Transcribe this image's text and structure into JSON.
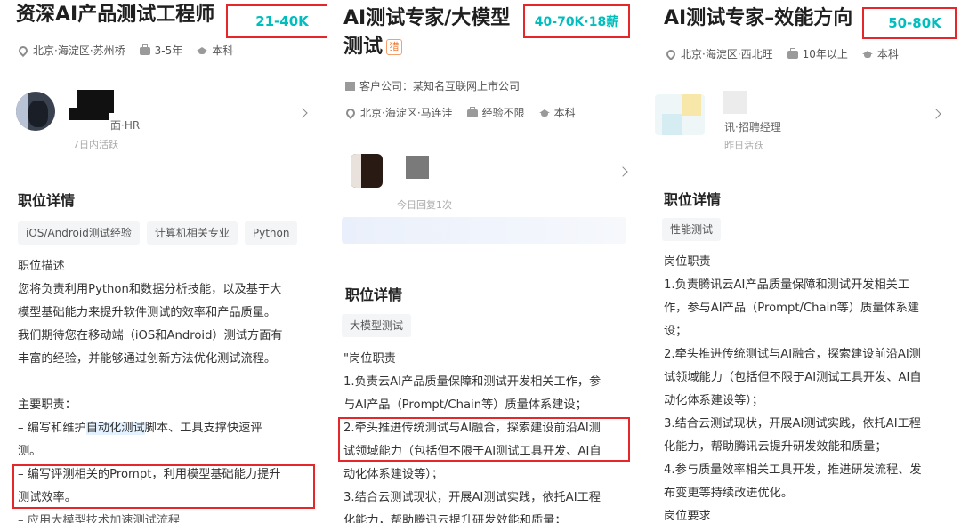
{
  "panel1": {
    "title": "资深AI产品测试工程师",
    "salary": "21-40K",
    "location": "北京·海淀区·苏州桥",
    "experience": "3-5年",
    "education": "本科",
    "hr_role": "面·HR",
    "hr_active": "7日内活跃",
    "section_title": "职位详情",
    "tags": [
      "iOS/Android测试经验",
      "计算机相关专业",
      "Python"
    ],
    "desc": {
      "heading": "职位描述",
      "p1": [
        "您将负责利用Python和数据分析技能，以及基于大",
        "模型基础能力来提升软件测试的效率和产品质量。",
        "我们期待您在移动端（iOS和Android）测试方面有",
        "丰富的经验，并能够通过创新方法优化测试流程。"
      ],
      "duties_heading": "主要职责：",
      "d1_pre": "– 编写和维护",
      "d1_hl": "自动化测试",
      "d1_post": "脚本、工具支撑快速评",
      "d1_l2": "测。",
      "d2": [
        "– 编写评测相关的Prompt，利用模型基础能力提升",
        "测试效率。"
      ],
      "d3": "– 应用大模型技术加速测试流程"
    }
  },
  "panel2": {
    "title_l1": "AI测试专家/大模型",
    "title_l2": "测试",
    "badge": "猎",
    "salary": "40-70K·18薪",
    "client": "客户公司：某知名互联网上市公司",
    "location": "北京·海淀区·马连洼",
    "experience": "经验不限",
    "education": "本科",
    "hr_active": "今日回复1次",
    "section_title": "职位详情",
    "tags": [
      "大模型测试"
    ],
    "lines": [
      "\"岗位职责",
      "1.负责云AI产品质量保障和测试开发相关工作，参",
      "与AI产品（Prompt/Chain等）质量体系建设；",
      "2.牵头推进传统测试与AI融合，探索建设前沿AI测",
      "试领域能力（包括但不限于AI测试工具开发、AI自",
      "动化体系建设等）；",
      "3.结合云测试现状，开展AI测试实践，依托AI工程",
      "化能力，帮助腾讯云提升研发效能和质量；"
    ]
  },
  "panel3": {
    "title": "AI测试专家–效能方向",
    "salary": "50-80K",
    "location": "北京·海淀区·西北旺",
    "experience": "10年以上",
    "education": "本科",
    "hr_role": "讯·招聘经理",
    "hr_active": "昨日活跃",
    "section_title": "职位详情",
    "tags": [
      "性能测试"
    ],
    "lines": [
      "岗位职责",
      "1.负责腾讯云AI产品质量保障和测试开发相关工",
      "作，参与AI产品（Prompt/Chain等）质量体系建",
      "设；",
      "2.牵头推进传统测试与AI融合，探索建设前沿AI测",
      "试领域能力（包括但不限于AI测试工具开发、AI自",
      "动化体系建设等）；",
      "3.结合云测试现状，开展AI测试实践，依托AI工程",
      "化能力，帮助腾讯云提升研发效能和质量；",
      "4.参与质量效率相关工具开发，推进研发流程、发",
      "布变更等持续改进优化。",
      "岗位要求"
    ]
  }
}
